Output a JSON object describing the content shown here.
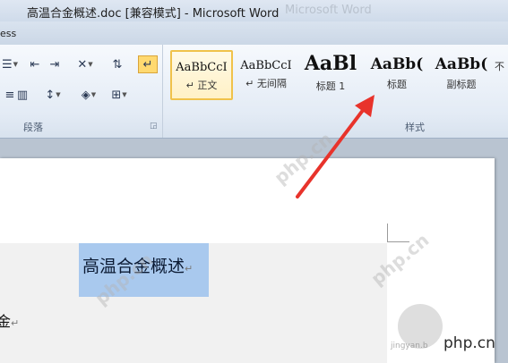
{
  "window": {
    "title": "高温合金概述.doc [兼容模式] - Microsoft Word",
    "ghost_title": "Microsoft Word"
  },
  "ribbon": {
    "tab_fragment": "ess",
    "paragraph_group": {
      "label": "段落",
      "row1": [
        "bullets",
        "decrease-indent",
        "increase-indent",
        "chinese-layout",
        "sort",
        "show-marks"
      ],
      "row2": [
        "distributed",
        "column",
        "line-spacing",
        "shading",
        "borders"
      ]
    },
    "styles_group": {
      "label": "样式",
      "tiles": [
        {
          "sample": "AaBbCcI",
          "name": "↵ 正文",
          "selected": true
        },
        {
          "sample": "AaBbCcI",
          "name": "↵ 无间隔",
          "selected": false
        },
        {
          "sample": "AaBl",
          "name": "标题 1",
          "selected": false
        },
        {
          "sample": "AaBb(",
          "name": "标题",
          "selected": false
        },
        {
          "sample": "AaBb(",
          "name": "副标题",
          "selected": false
        },
        {
          "sample": "",
          "name": "不",
          "selected": false
        }
      ]
    }
  },
  "document": {
    "heading": "高温合金概述",
    "body_fragment": "金"
  },
  "watermark": {
    "small": "jingyan.b",
    "brand": "php.cn",
    "diagonal": "php.cn"
  },
  "colors": {
    "selection": "#a9c9ee",
    "arrow": "#e8332b",
    "selected_tile": "#f0c24a"
  }
}
